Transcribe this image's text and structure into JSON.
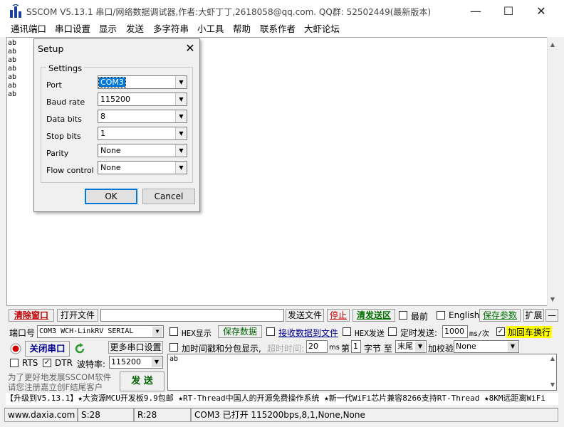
{
  "window": {
    "title": "SSCOM V5.13.1 串口/网络数据调试器,作者:大虾丁丁,2618058@qq.com. QQ群: 52502449(最新版本)"
  },
  "menu": [
    "通讯端口",
    "串口设置",
    "显示",
    "发送",
    "多字符串",
    "小工具",
    "帮助",
    "联系作者",
    "大虾论坛"
  ],
  "receive_lines": [
    "ab",
    "ab",
    "ab",
    "ab",
    "ab",
    "ab",
    "ab"
  ],
  "dialog": {
    "title": "Setup",
    "group_label": "Settings",
    "fields": [
      {
        "label": "Port",
        "value": "COM3"
      },
      {
        "label": "Baud rate",
        "value": "115200"
      },
      {
        "label": "Data bits",
        "value": "8"
      },
      {
        "label": "Stop bits",
        "value": "1"
      },
      {
        "label": "Parity",
        "value": "None"
      },
      {
        "label": "Flow control",
        "value": "None"
      }
    ],
    "ok_label": "OK",
    "cancel_label": "Cancel"
  },
  "toolbar1": {
    "clear_window": "清除窗口",
    "open_file": "打开文件",
    "send_file": "发送文件",
    "stop": "停止",
    "clear_send": "清发送区",
    "topmost": "最前",
    "english": "English",
    "save_params": "保存参数",
    "expand": "扩展",
    "collapse": "—"
  },
  "port_row": {
    "port_label": "端口号",
    "port_value": "COM3 WCH-LinkRV SERIAL",
    "hex_display": "HEX显示",
    "save_data": "保存数据",
    "recv_to_file": "接收数据到文件",
    "hex_send": "HEX发送",
    "timed_send": "定时发送:",
    "interval": "1000",
    "interval_unit": "ms/次",
    "add_crlf": "加回车换行"
  },
  "row3": {
    "close_port": "关闭串口",
    "more_settings": "更多串口设置",
    "timestamp": "加时间戳和分包显示,",
    "timeout_label": "超时时间:",
    "timeout_value": "20",
    "ms": "ms",
    "nth": "第",
    "byte_no": "1",
    "bytes_to": "字节 至",
    "end": "末尾",
    "checksum_label": "加校验",
    "checksum_value": "None"
  },
  "row4": {
    "rts": "RTS",
    "dtr": "DTR",
    "baud_label": "波特率:",
    "baud_value": "115200"
  },
  "promo": {
    "line1": "为了更好地发展SSCOM软件",
    "line2": "请您注册嘉立创F结尾客户"
  },
  "send_button": "发 送",
  "send_text": "ab",
  "marquee": "【升级到V5.13.1】★大资源MCU开发板9.9包邮 ★RT-Thread中国人的开源免费操作系统 ★新一代WiFi芯片兼容8266支持RT-Thread ★8KM远距离WiFi",
  "status": {
    "url": "www.daxia.com",
    "sent": "S:28",
    "received": "R:28",
    "port_status": "COM3 已打开  115200bps,8,1,None,None"
  },
  "colors": {
    "accent": "#0078d7",
    "red_text": "#c00000",
    "green_text": "#007000",
    "highlight": "#ffff00"
  }
}
